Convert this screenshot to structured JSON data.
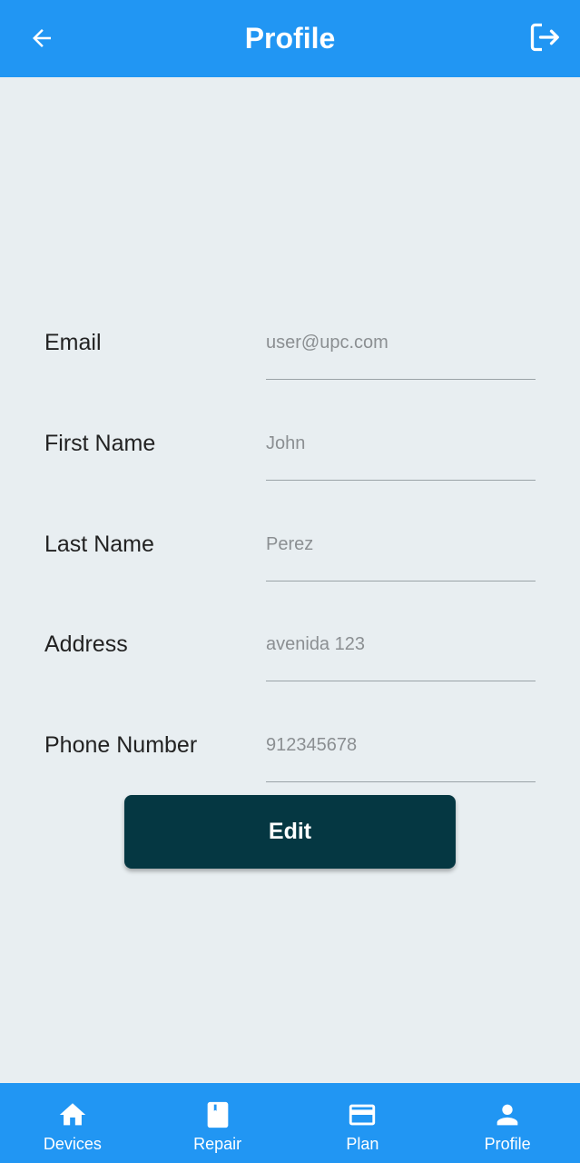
{
  "appbar": {
    "title": "Profile",
    "back_icon": "arrow-left-icon",
    "logout_icon": "logout-icon"
  },
  "form": {
    "fields": [
      {
        "label": "Email",
        "value": "user@upc.com"
      },
      {
        "label": "First Name",
        "value": "John"
      },
      {
        "label": "Last Name",
        "value": "Perez"
      },
      {
        "label": "Address",
        "value": "avenida 123"
      },
      {
        "label": "Phone Number",
        "value": "912345678"
      }
    ],
    "edit_label": "Edit"
  },
  "nav": {
    "items": [
      {
        "label": "Devices",
        "icon": "home-icon"
      },
      {
        "label": "Repair",
        "icon": "book-icon"
      },
      {
        "label": "Plan",
        "icon": "credit-card-icon"
      },
      {
        "label": "Profile",
        "icon": "person-icon"
      }
    ]
  },
  "colors": {
    "primary": "#2196f3",
    "background": "#e8eef1",
    "button": "#053742"
  }
}
